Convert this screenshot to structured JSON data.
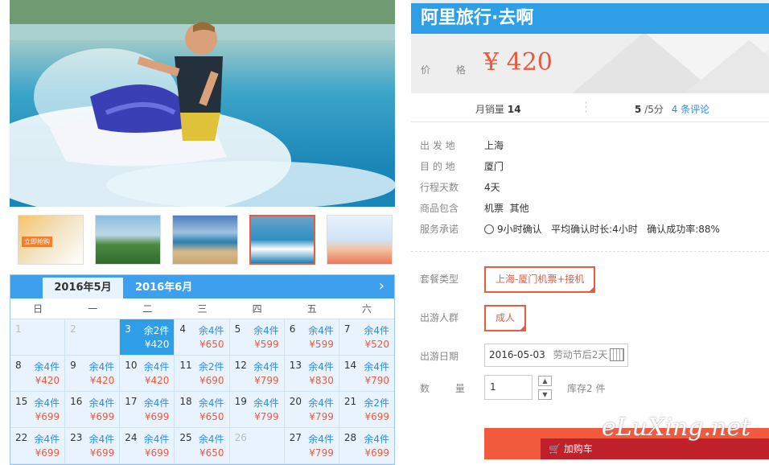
{
  "product": {
    "title": "阿里旅行·去啊",
    "price_label": "价 格",
    "price": "¥ 420"
  },
  "stats": {
    "monthly_sales_label": "月销量",
    "monthly_sales": "14",
    "rating": "5",
    "rating_suffix": "/5分",
    "reviews": "4 条评论"
  },
  "info": [
    {
      "label": "出 发 地",
      "value": "上海"
    },
    {
      "label": "目 的 地",
      "value": "厦门"
    },
    {
      "label": "行程天数",
      "value": "4天"
    },
    {
      "label": "商品包含",
      "value": "机票  其他"
    }
  ],
  "service": {
    "label": "服务承诺",
    "confirm": "9小时确认",
    "avg": "平均确认时长:4小时",
    "rate": "确认成功率:88%"
  },
  "package": {
    "label": "套餐类型",
    "value": "上海-厦门机票+接机"
  },
  "crowd": {
    "label": "出游人群",
    "value": "成人"
  },
  "date": {
    "label": "出游日期",
    "value": "2016-05-03",
    "hint": "劳动节后2天"
  },
  "quantity": {
    "label": "数 量",
    "value": "1",
    "stock": "库存2 件"
  },
  "buy_label": "加购车",
  "watermark": "eLuXing.net",
  "calendar": {
    "tab_active": "2016年5月",
    "tab_other": "2016年6月",
    "weekdays": [
      "日",
      "一",
      "二",
      "三",
      "四",
      "五",
      "六"
    ],
    "days": [
      {
        "d": "1",
        "r": "",
        "p": "",
        "dim": true
      },
      {
        "d": "2",
        "r": "",
        "p": "",
        "dim": true
      },
      {
        "d": "3",
        "r": "余2件",
        "p": "¥420",
        "sel": true
      },
      {
        "d": "4",
        "r": "余4件",
        "p": "¥650"
      },
      {
        "d": "5",
        "r": "余4件",
        "p": "¥599"
      },
      {
        "d": "6",
        "r": "余4件",
        "p": "¥599"
      },
      {
        "d": "7",
        "r": "余4件",
        "p": "¥520"
      },
      {
        "d": "8",
        "r": "余4件",
        "p": "¥420"
      },
      {
        "d": "9",
        "r": "余4件",
        "p": "¥420"
      },
      {
        "d": "10",
        "r": "余4件",
        "p": "¥420"
      },
      {
        "d": "11",
        "r": "余2件",
        "p": "¥690"
      },
      {
        "d": "12",
        "r": "余4件",
        "p": "¥799"
      },
      {
        "d": "13",
        "r": "余4件",
        "p": "¥830"
      },
      {
        "d": "14",
        "r": "余4件",
        "p": "¥790"
      },
      {
        "d": "15",
        "r": "余4件",
        "p": "¥699"
      },
      {
        "d": "16",
        "r": "余4件",
        "p": "¥699"
      },
      {
        "d": "17",
        "r": "余4件",
        "p": "¥699"
      },
      {
        "d": "18",
        "r": "余4件",
        "p": "¥650"
      },
      {
        "d": "19",
        "r": "余4件",
        "p": "¥799"
      },
      {
        "d": "20",
        "r": "余4件",
        "p": "¥799"
      },
      {
        "d": "21",
        "r": "余2件",
        "p": "¥699"
      },
      {
        "d": "22",
        "r": "余4件",
        "p": "¥699"
      },
      {
        "d": "23",
        "r": "余4件",
        "p": "¥699"
      },
      {
        "d": "24",
        "r": "余4件",
        "p": "¥699"
      },
      {
        "d": "25",
        "r": "余4件",
        "p": "¥650"
      },
      {
        "d": "26",
        "r": "",
        "p": "",
        "dim": true
      },
      {
        "d": "27",
        "r": "余4件",
        "p": "¥799"
      },
      {
        "d": "28",
        "r": "余4件",
        "p": "¥699"
      }
    ]
  },
  "thumb_badge": "立即抢购"
}
